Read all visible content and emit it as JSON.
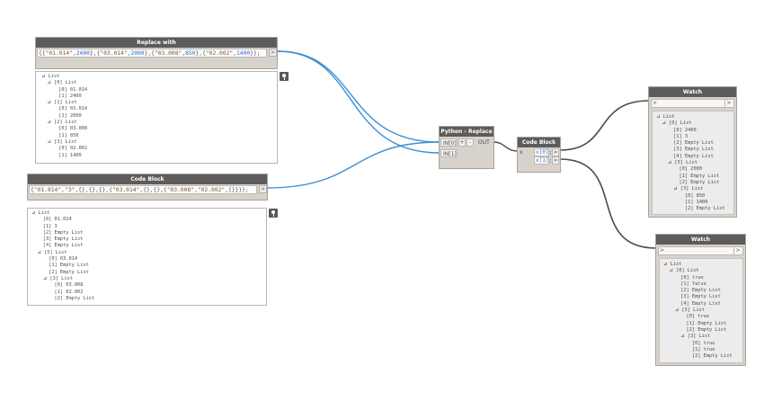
{
  "replace_node": {
    "title": "Replace with",
    "code_segments": [
      {
        "t": "{{",
        "c": "p"
      },
      {
        "t": "\"01.014\"",
        "c": "s"
      },
      {
        "t": ",",
        "c": "p"
      },
      {
        "t": "2400",
        "c": "n"
      },
      {
        "t": "},{",
        "c": "p"
      },
      {
        "t": "\"03.014\"",
        "c": "s"
      },
      {
        "t": ",",
        "c": "p"
      },
      {
        "t": "2000",
        "c": "n"
      },
      {
        "t": "},{",
        "c": "p"
      },
      {
        "t": "\"03.008\"",
        "c": "s"
      },
      {
        "t": ",",
        "c": "p"
      },
      {
        "t": "850",
        "c": "n"
      },
      {
        "t": "},{",
        "c": "p"
      },
      {
        "t": "\"02.002\"",
        "c": "s"
      },
      {
        "t": ",",
        "c": "p"
      },
      {
        "t": "1400",
        "c": "n"
      },
      {
        "t": "}};",
        "c": "p"
      }
    ],
    "out_label": ">",
    "preview": [
      "⊿ List",
      "  ⊿ [0] List",
      "      [0] 01.014",
      "      [1] 2400",
      "  ⊿ [1] List",
      "      [0] 03.014",
      "      [1] 2000",
      "  ⊿ [2] List",
      "      [0] 03.008",
      "      [1] 850",
      "  ⊿ [3] List",
      "      [0] 02.002",
      "      [1] 1400"
    ]
  },
  "code_block_1": {
    "title": "Code Block",
    "code_segments": [
      {
        "t": "{",
        "c": "p"
      },
      {
        "t": "\"01.014\"",
        "c": "s"
      },
      {
        "t": ",",
        "c": "p"
      },
      {
        "t": "\"3\"",
        "c": "s"
      },
      {
        "t": ",{},{},{},{",
        "c": "p"
      },
      {
        "t": "\"03.014\"",
        "c": "s"
      },
      {
        "t": ",{},{},{",
        "c": "p"
      },
      {
        "t": "\"03.008\"",
        "c": "s"
      },
      {
        "t": ",",
        "c": "p"
      },
      {
        "t": "\"02.002\"",
        "c": "s"
      },
      {
        "t": ",{}}}};",
        "c": "p"
      }
    ],
    "out_label": ">",
    "preview": [
      "⊿ List",
      "    [0] 01.014",
      "    [1] 3",
      "    [2] Empty List",
      "    [3] Empty List",
      "    [4] Empty List",
      "  ⊿ [5] List",
      "      [0] 03.014",
      "      [1] Empty List",
      "      [2] Empty List",
      "    ⊿ [3] List",
      "        [0] 03.008",
      "        [1] 02.002",
      "        [2] Empty List"
    ]
  },
  "python_node": {
    "title": "Python - Replace",
    "in0": "IN[0]",
    "plus": "+",
    "minus": "-",
    "out": "OUT",
    "in1": "IN[1]"
  },
  "code_block_2": {
    "title": "Code Block",
    "x_label": "x",
    "line1": "x[0];",
    "line2": "x[1];",
    "out1": ">",
    "out2": ">"
  },
  "watch_1": {
    "title": "Watch",
    "in_label": ">",
    "out_label": ">",
    "tree": [
      "⊿ List",
      "  ⊿ [0] List",
      "      [0] 2400",
      "      [1] 3",
      "      [2] Empty List",
      "      [3] Empty List",
      "      [4] Empty List",
      "    ⊿ [5] List",
      "        [0] 2000",
      "        [1] Empty List",
      "        [2] Empty List",
      "      ⊿ [3] List",
      "          [0] 850",
      "          [1] 1400",
      "          [2] Empty List"
    ]
  },
  "watch_2": {
    "title": "Watch",
    "in_label": ">",
    "out_label": ">",
    "tree": [
      "⊿ List",
      "  ⊿ [0] List",
      "      [0] true",
      "      [1] false",
      "      [2] Empty List",
      "      [3] Empty List",
      "      [4] Empty List",
      "    ⊿ [5] List",
      "        [0] true",
      "        [1] Empty List",
      "        [2] Empty List",
      "      ⊿ [3] List",
      "          [0] true",
      "          [1] true",
      "          [2] Empty List"
    ]
  },
  "colors": {
    "wire_selected": "#3a8fd6",
    "wire_normal": "#4a4a4a",
    "node_title": "#5e5c5a",
    "node_body": "#d7d2cb"
  }
}
